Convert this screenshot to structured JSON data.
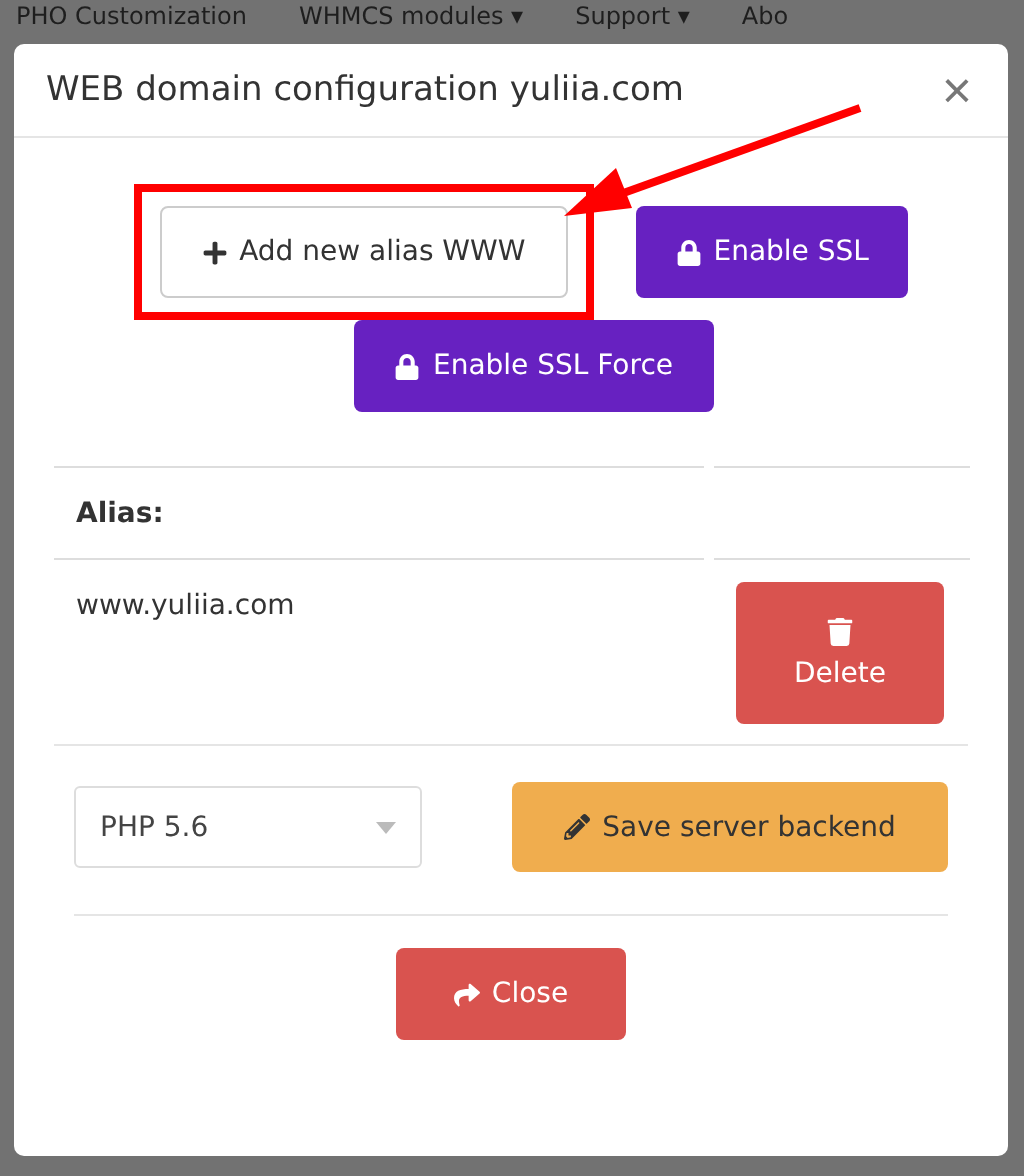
{
  "background_nav": [
    "PHO Customization",
    "WHMCS modules ▾",
    "Support ▾",
    "Abo"
  ],
  "dialog": {
    "title": "WEB domain configuration yuliia.com",
    "close_glyph": "×"
  },
  "actions": [
    {
      "kind": "add",
      "label": "Add new alias WWW",
      "highlighted": true
    },
    {
      "kind": "ssl",
      "label": "Enable SSL",
      "highlighted": false
    },
    {
      "kind": "ssl",
      "label": "Enable SSL Force",
      "highlighted": false
    }
  ],
  "table": {
    "columns": [
      "Alias:"
    ],
    "rows": [
      {
        "alias": "www.yuliia.com",
        "action": "Delete"
      }
    ]
  },
  "php_select": {
    "value": "PHP 5.6"
  },
  "save_button": "Save server backend",
  "close_button": "Close"
}
